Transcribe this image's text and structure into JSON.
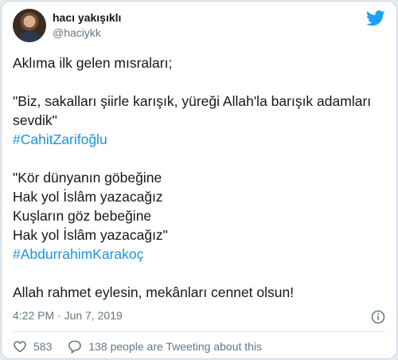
{
  "author": {
    "display_name": "hacı yakışıklı",
    "handle": "@haciykk"
  },
  "tweet": {
    "line1": "Aklıma ilk gelen mısraları;",
    "quote1_line1": "\"Biz, sakalları şiirle karışık, yüreği Allah'la barışık adamları",
    "quote1_line2": "sevdik\"",
    "hashtag1": "#CahitZarifoğlu",
    "quote2_line1": "\"Kör dünyanın göbeğine",
    "quote2_line2": "Hak yol İslâm yazacağız",
    "quote2_line3": "Kuşların göz bebeğine",
    "quote2_line4": "Hak yol İslâm yazacağız\"",
    "hashtag2": "#AbdurrahimKarakoç",
    "closing": "Allah rahmet eylesin, mekânları cennet olsun!"
  },
  "meta": {
    "time": "4:22 PM",
    "separator": "·",
    "date": "Jun 7, 2019"
  },
  "actions": {
    "likes": "583",
    "tweeting_text": "138 people are Tweeting about this"
  },
  "icons": {
    "brand": "twitter-bird-icon",
    "info": "info-icon",
    "like": "heart-icon",
    "reply": "speech-bubble-icon"
  },
  "colors": {
    "brand": "#1da1f2",
    "hashtag": "#1b95e0",
    "secondary_text": "#657786"
  }
}
